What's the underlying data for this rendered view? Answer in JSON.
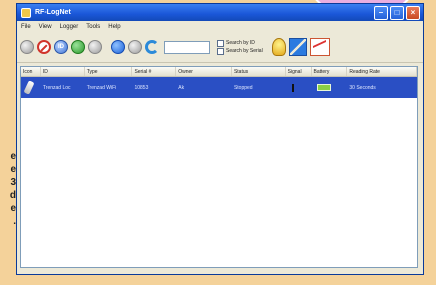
{
  "window": {
    "title": "RF-LogNet"
  },
  "menu": [
    "File",
    "View",
    "Logger",
    "Tools",
    "Help"
  ],
  "toolbar": {
    "search_by_id": "Search by ID",
    "search_by_serial": "Search by Serial",
    "search_value": ""
  },
  "columns": [
    "Icon",
    "ID",
    "Type",
    "Serial #",
    "Owner",
    "Status",
    "Signal",
    "Battery",
    "Reading Rate"
  ],
  "rows": [
    {
      "id": "Trenzad Loc",
      "type": "Trenzad WiFi",
      "serial": "10853",
      "owner": "Ak",
      "status": "Stopped",
      "reading_rate": "30 Seconds"
    }
  ],
  "side_text": [
    "e",
    "e",
    "3",
    "d",
    "e",
    "."
  ],
  "colors": {
    "selection": "#2a4fc4",
    "titlebar": "#1a56d8",
    "page_bg": "#f4d29a"
  }
}
